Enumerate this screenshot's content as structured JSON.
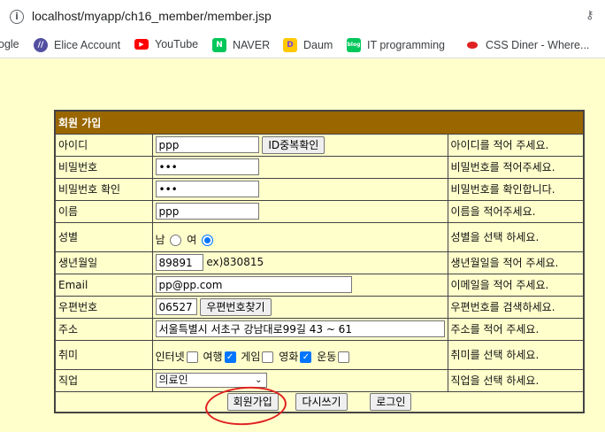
{
  "browser": {
    "url": "localhost/myapp/ch16_member/member.jsp",
    "bookmarks": [
      {
        "label": "ogle",
        "icon": "google-icon",
        "color": "#4285f4"
      },
      {
        "label": "Elice Account",
        "icon": "elice-icon",
        "color": "#524fa1"
      },
      {
        "label": "YouTube",
        "icon": "youtube-icon",
        "color": "#ff0000"
      },
      {
        "label": "NAVER",
        "icon": "naver-icon",
        "color": "#03c75a"
      },
      {
        "label": "Daum",
        "icon": "daum-icon",
        "color": "#ffc900"
      },
      {
        "label": "IT programming",
        "icon": "blog-icon",
        "color": "#03c75a"
      },
      {
        "label": "CSS Diner - Where...",
        "icon": "css-diner-icon",
        "color": "#e02020"
      }
    ]
  },
  "form": {
    "title": "회원 가입",
    "header_color": "#996600",
    "rows": [
      {
        "label": "아이디",
        "value": "ppp",
        "button": "ID중복확인",
        "hint": "아이디를 적어 주세요."
      },
      {
        "label": "비밀번호",
        "value": "•••",
        "hint": "비밀번호를 적어주세요."
      },
      {
        "label": "비밀번호 확인",
        "value": "•••",
        "hint": "비밀번호를 확인합니다."
      },
      {
        "label": "이름",
        "value": "ppp",
        "hint": "이름을 적어주세요."
      },
      {
        "label": "성별",
        "options": [
          "남",
          "여"
        ],
        "selected": "여",
        "hint": "성별을 선택 하세요."
      },
      {
        "label": "생년월일",
        "value": "89891",
        "example": "ex)830815",
        "hint": "생년월일을 적어 주세요."
      },
      {
        "label": "Email",
        "value": "pp@pp.com",
        "hint": "이메일을 적어 주세요."
      },
      {
        "label": "우편번호",
        "value": "06527",
        "button": "우편번호찾기",
        "hint": "우편번호를 검색하세요."
      },
      {
        "label": "주소",
        "value": "서울특별시 서초구 강남대로99길 43 ~ 61",
        "hint": "주소를 적어 주세요."
      },
      {
        "label": "취미",
        "hobbies": [
          "인터넷",
          "여행",
          "게임",
          "영화",
          "운동"
        ],
        "checked": [
          false,
          true,
          false,
          true,
          false
        ],
        "hint": "취미를 선택 하세요."
      },
      {
        "label": "직업",
        "value": "의료인",
        "hint": "직업을 선택 하세요."
      }
    ],
    "buttons": {
      "submit": "회원가입",
      "reset": "다시쓰기",
      "login": "로그인"
    }
  }
}
